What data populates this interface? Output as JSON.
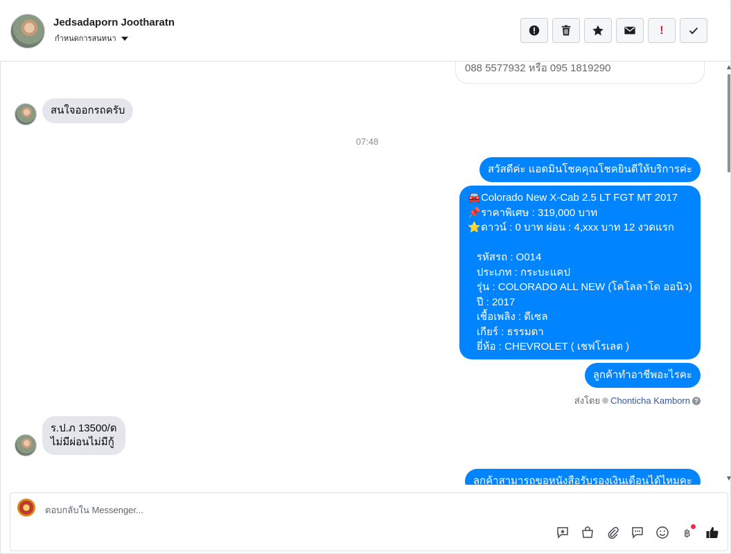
{
  "header": {
    "contact_name": "Jedsadaporn Jootharatn",
    "assign_label": "กำหนดการสนทนา",
    "actions": [
      {
        "name": "spam-icon",
        "label": ""
      },
      {
        "name": "trash-icon",
        "label": ""
      },
      {
        "name": "star-icon",
        "label": ""
      },
      {
        "name": "envelope-icon",
        "label": ""
      },
      {
        "name": "important-icon",
        "label": "!"
      },
      {
        "name": "check-icon",
        "label": ""
      }
    ]
  },
  "chat": {
    "previous_message_tail": "088 5577932 หรือ 095 1819290",
    "incoming_1": "สนใจออกรถครับ",
    "timestamp": "07:48",
    "outgoing_1": "สวัสดีค่ะ แอดมินโชคคุณโชคยินดีให้บริการค่ะ",
    "outgoing_2": "🚘Colorado New X-Cab 2.5 LT FGT MT 2017\n📌ราคาพิเศษ : 319,000 บาท\n⭐ดาวน์ : 0 บาท ผ่อน : 4,xxx บาท 12 งวดแรก\n\n   รหัสรถ : O014\n   ประเภท : กระบะแคป\n   รุ่น : COLORADO ALL NEW (โคโลลาโด ออนิว)\n   ปี : 2017\n   เชื้อเพลิง : ดีเซล\n   เกียร์ : ธรรมดา\n   ยี่ห้อ : CHEVROLET ( เชฟโรเลต )",
    "outgoing_3": "ลูกค้าทำอาชีพอะไรคะ",
    "sent_by_label": "ส่งโดย",
    "sent_by_agent": "Chonticha Kamborn",
    "incoming_2": "ร.ป.ภ 13500/ด\nไม่มีผ่อนไม่มีกู้",
    "outgoing_4": "ลูกค้าสามารถขอหนังสือรับรองเงินเดือนได้ไหมคะ"
  },
  "composer": {
    "placeholder": "ตอบกลับใน Messenger...",
    "tools": [
      "saved-reply-icon",
      "shop-icon",
      "attachment-icon",
      "message-icon",
      "emoji-icon",
      "baht-payment-icon",
      "thumbs-up-icon"
    ]
  },
  "colors": {
    "outgoing_bubble": "#0084ff",
    "incoming_bubble": "#e4e6eb",
    "alert_red": "#e41e3f"
  }
}
